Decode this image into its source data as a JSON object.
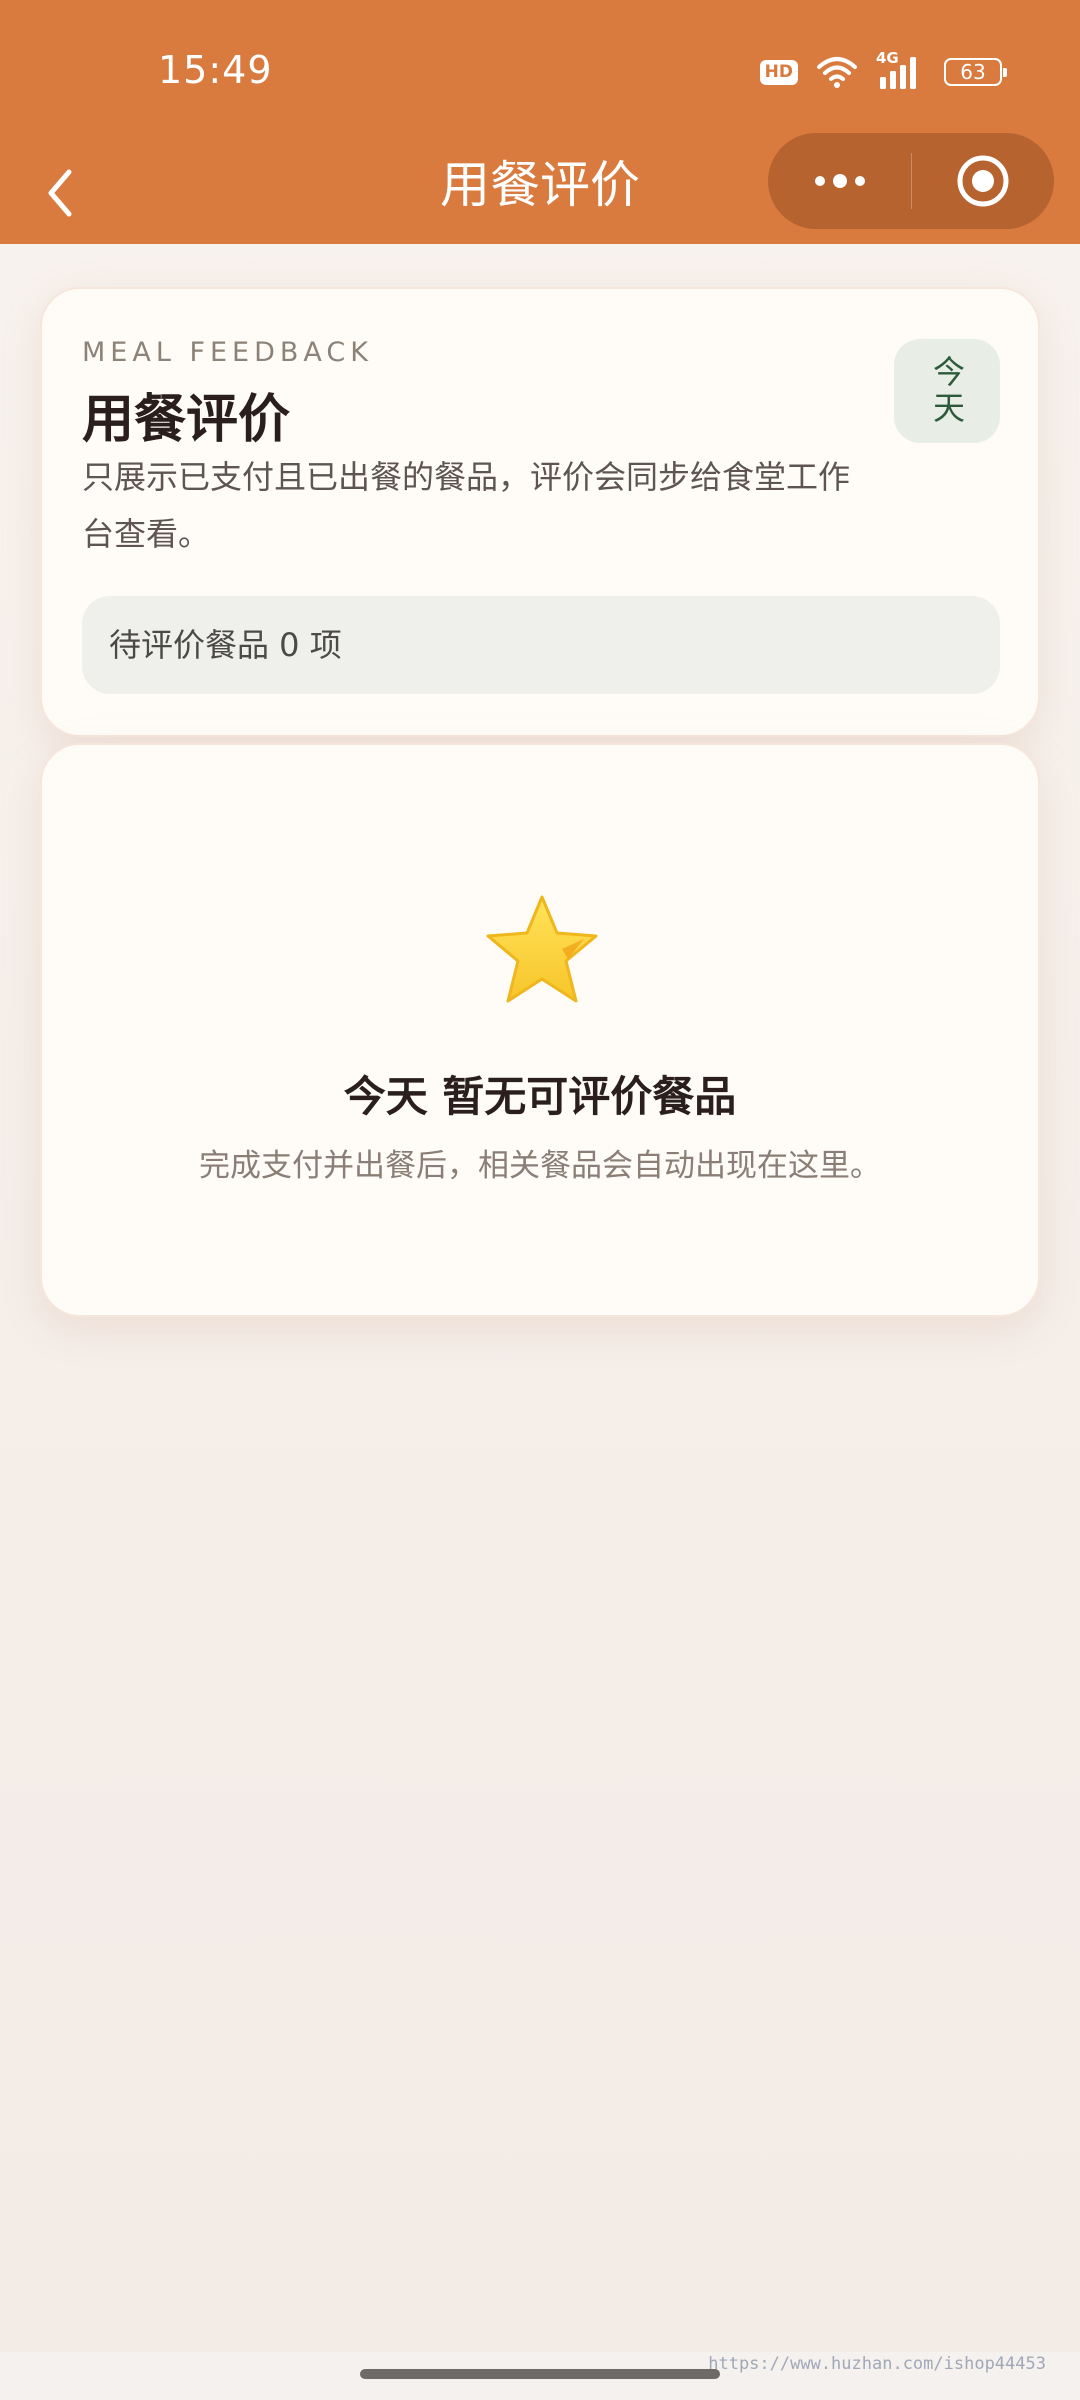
{
  "status_bar": {
    "time": "15:49",
    "hd_badge": "HD",
    "network_type": "4G",
    "battery_level": "63",
    "icons": [
      "hd-icon",
      "wifi-icon",
      "signal-icon",
      "battery-icon"
    ]
  },
  "nav": {
    "title": "用餐评价",
    "back_icon": "chevron-left-icon",
    "more_icon": "more-dots-icon",
    "close_icon": "target-close-icon"
  },
  "summary": {
    "eyebrow": "MEAL FEEDBACK",
    "title": "用餐评价",
    "description": "只展示已支付且已出餐的餐品，评价会同步给食堂工作台查看。",
    "date_chip": "今天",
    "pending_text": "待评价餐品 0 项"
  },
  "empty_state": {
    "icon": "star-icon",
    "title": "今天 暂无可评价餐品",
    "subtitle": "完成支付并出餐后，相关餐品会自动出现在这里。"
  },
  "footer": {
    "watermark": "https://www.huzhan.com/ishop44453"
  },
  "colors": {
    "header": "#d97b3f",
    "card_bg": "#fffcf8",
    "chip_bg": "#e8ede6",
    "chip_text": "#2d5a3a",
    "star": "#fbd23c"
  }
}
